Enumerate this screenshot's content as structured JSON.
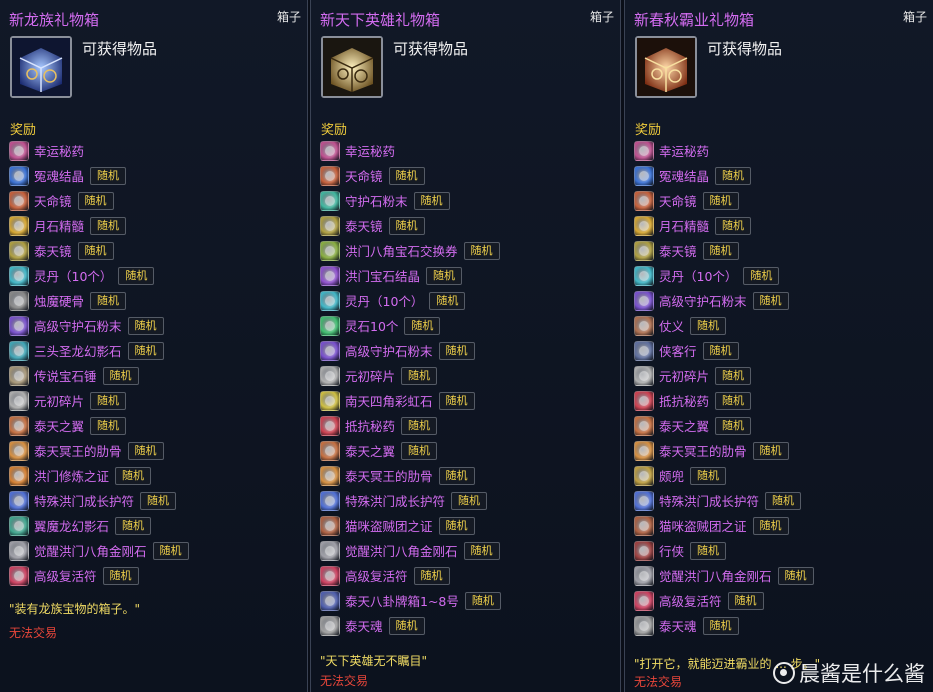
{
  "panels": [
    {
      "title": "新龙族礼物箱",
      "type": "箱子",
      "obtain": "可获得物品",
      "box_color": "#3f68c8",
      "reward_label": "奖励",
      "items": [
        {
          "name": "幸运秘药",
          "random": "",
          "color": "#c05090"
        },
        {
          "name": "冤魂结晶",
          "random": "随机",
          "color": "#3a72d8"
        },
        {
          "name": "天命镜",
          "random": "随机",
          "color": "#c8603a"
        },
        {
          "name": "月石精髓",
          "random": "随机",
          "color": "#d8a830"
        },
        {
          "name": "泰天镜",
          "random": "随机",
          "color": "#b0a040"
        },
        {
          "name": "灵丹（10个）",
          "random": "随机",
          "color": "#40b8c8"
        },
        {
          "name": "烛魔硬骨",
          "random": "随机",
          "color": "#8a8a8a"
        },
        {
          "name": "高级守护石粉末",
          "random": "随机",
          "color": "#7a50d0"
        },
        {
          "name": "三头圣龙幻影石",
          "random": "随机",
          "color": "#40a8b8"
        },
        {
          "name": "传说宝石锤",
          "random": "随机",
          "color": "#a89878"
        },
        {
          "name": "元初碎片",
          "random": "随机",
          "color": "#b0b0b0"
        },
        {
          "name": "泰天之翼",
          "random": "随机",
          "color": "#c87040"
        },
        {
          "name": "泰天冥王的肋骨",
          "random": "随机",
          "color": "#d89040"
        },
        {
          "name": "洪门修炼之证",
          "random": "随机",
          "color": "#d88030"
        },
        {
          "name": "特殊洪门成长护符",
          "random": "随机",
          "color": "#5070d8"
        },
        {
          "name": "翼魔龙幻影石",
          "random": "随机",
          "color": "#40a890"
        },
        {
          "name": "觉醒洪门八角金刚石",
          "random": "随机",
          "color": "#a0a0a8"
        },
        {
          "name": "高级复活符",
          "random": "随机",
          "color": "#d04060"
        }
      ],
      "description": "\"装有龙族宝物的箱子。\"",
      "trade": "无法交易"
    },
    {
      "title": "新天下英雄礼物箱",
      "type": "箱子",
      "obtain": "可获得物品",
      "box_color": "#c8a858",
      "reward_label": "奖励",
      "items": [
        {
          "name": "幸运秘药",
          "random": "",
          "color": "#c05090"
        },
        {
          "name": "天命镜",
          "random": "随机",
          "color": "#c8603a"
        },
        {
          "name": "守护石粉末",
          "random": "随机",
          "color": "#40b8a0"
        },
        {
          "name": "泰天镜",
          "random": "随机",
          "color": "#b0a040"
        },
        {
          "name": "洪门八角宝石交换券",
          "random": "随机",
          "color": "#8ab040"
        },
        {
          "name": "洪门宝石结晶",
          "random": "随机",
          "color": "#9050d0"
        },
        {
          "name": "灵丹（10个）",
          "random": "随机",
          "color": "#40b8c8"
        },
        {
          "name": "灵石10个",
          "random": "随机",
          "color": "#40c070"
        },
        {
          "name": "高级守护石粉末",
          "random": "随机",
          "color": "#7a50d0"
        },
        {
          "name": "元初碎片",
          "random": "随机",
          "color": "#b0b0b0"
        },
        {
          "name": "南天四角彩虹石",
          "random": "随机",
          "color": "#d0c040"
        },
        {
          "name": "抵抗秘药",
          "random": "随机",
          "color": "#d04050"
        },
        {
          "name": "泰天之翼",
          "random": "随机",
          "color": "#c87040"
        },
        {
          "name": "泰天冥王的肋骨",
          "random": "随机",
          "color": "#d89040"
        },
        {
          "name": "特殊洪门成长护符",
          "random": "随机",
          "color": "#5070d8"
        },
        {
          "name": "猫咪盗贼团之证",
          "random": "随机",
          "color": "#b06040"
        },
        {
          "name": "觉醒洪门八角金刚石",
          "random": "随机",
          "color": "#a0a0a8"
        },
        {
          "name": "高级复活符",
          "random": "随机",
          "color": "#d04060"
        },
        {
          "name": "泰天八卦牌箱1~8号",
          "random": "随机",
          "color": "#5060b0"
        },
        {
          "name": "泰天魂",
          "random": "随机",
          "color": "#a0a0a0"
        }
      ],
      "description": "\"天下英雄无不瞩目\"",
      "trade": "无法交易"
    },
    {
      "title": "新春秋霸业礼物箱",
      "type": "箱子",
      "obtain": "可获得物品",
      "box_color": "#d06830",
      "reward_label": "奖励",
      "items": [
        {
          "name": "幸运秘药",
          "random": "",
          "color": "#c05090"
        },
        {
          "name": "冤魂结晶",
          "random": "随机",
          "color": "#3a72d8"
        },
        {
          "name": "天命镜",
          "random": "随机",
          "color": "#c8603a"
        },
        {
          "name": "月石精髓",
          "random": "随机",
          "color": "#d8a830"
        },
        {
          "name": "泰天镜",
          "random": "随机",
          "color": "#b0a040"
        },
        {
          "name": "灵丹（10个）",
          "random": "随机",
          "color": "#40b8c8"
        },
        {
          "name": "高级守护石粉末",
          "random": "随机",
          "color": "#7a50d0"
        },
        {
          "name": "仗义",
          "random": "随机",
          "color": "#b07050"
        },
        {
          "name": "侠客行",
          "random": "随机",
          "color": "#6070a0"
        },
        {
          "name": "元初碎片",
          "random": "随机",
          "color": "#b0b0b0"
        },
        {
          "name": "抵抗秘药",
          "random": "随机",
          "color": "#d04050"
        },
        {
          "name": "泰天之翼",
          "random": "随机",
          "color": "#c87040"
        },
        {
          "name": "泰天冥王的肋骨",
          "random": "随机",
          "color": "#d89040"
        },
        {
          "name": "颇兜",
          "random": "随机",
          "color": "#c0a040"
        },
        {
          "name": "特殊洪门成长护符",
          "random": "随机",
          "color": "#5070d8"
        },
        {
          "name": "猫咪盗贼团之证",
          "random": "随机",
          "color": "#b06040"
        },
        {
          "name": "行侠",
          "random": "随机",
          "color": "#a04040"
        },
        {
          "name": "觉醒洪门八角金刚石",
          "random": "随机",
          "color": "#a0a0a8"
        },
        {
          "name": "高级复活符",
          "random": "随机",
          "color": "#d04060"
        },
        {
          "name": "泰天魂",
          "random": "随机",
          "color": "#a0a0a0"
        }
      ],
      "description": "\"打开它，就能迈进霸业的 ... 步。\"",
      "trade": "无法交易"
    }
  ],
  "watermark": "晨酱是什么酱"
}
